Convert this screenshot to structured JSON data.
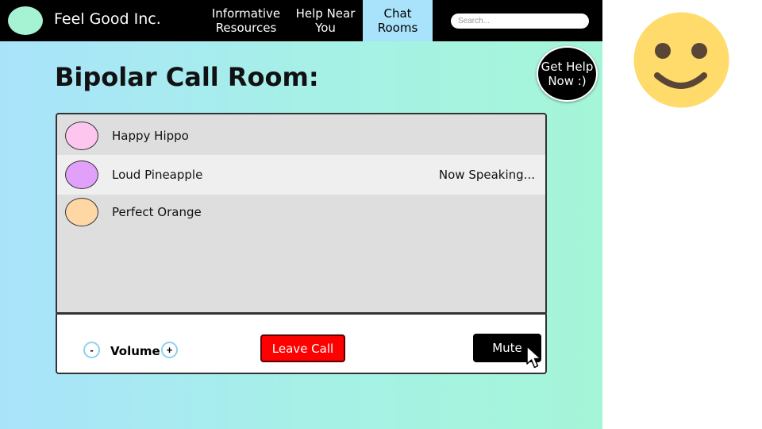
{
  "header": {
    "brand": "Feel Good Inc.",
    "nav": [
      {
        "label": "Informative\nResources"
      },
      {
        "label": "Help Near\nYou"
      },
      {
        "label": "Chat\nRooms",
        "active": true
      }
    ],
    "search_placeholder": "Search..."
  },
  "help_bubble": {
    "label": "Get Help\nNow :)"
  },
  "page": {
    "title": "Bipolar Call Room:"
  },
  "participants": [
    {
      "name": "Happy Hippo",
      "avatar_color": "#fdc6ee",
      "status": ""
    },
    {
      "name": "Loud Pineapple",
      "avatar_color": "#e1a1fb",
      "status": "Now Speaking..."
    },
    {
      "name": "Perfect Orange",
      "avatar_color": "#fed7a4",
      "status": ""
    }
  ],
  "controls": {
    "volume_minus": "-",
    "volume_label": "Volume",
    "volume_plus": "+",
    "leave_label": "Leave Call",
    "mute_label": "Mute"
  },
  "colors": {
    "nav_bg": "#000000",
    "active_tab": "#a9e3fb",
    "leave": "#ff0000",
    "smiley": "#fedb6a"
  }
}
